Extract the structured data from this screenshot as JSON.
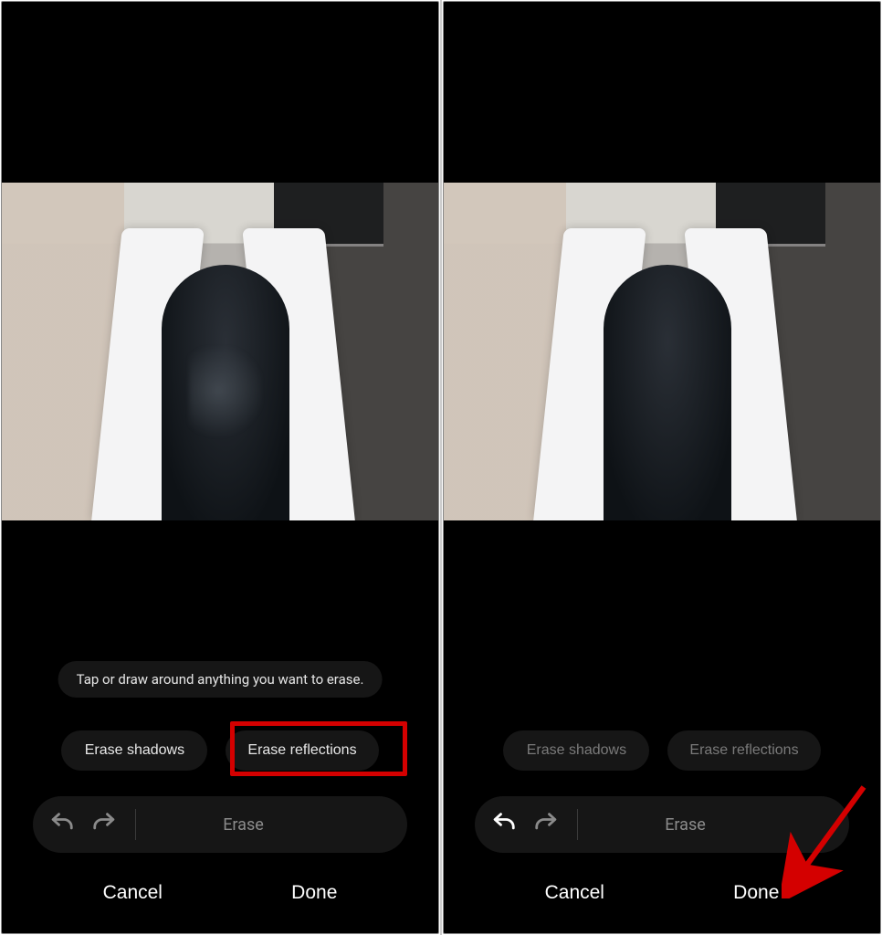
{
  "hint": "Tap or draw around anything you want to erase.",
  "chips": {
    "shadows": "Erase shadows",
    "reflections": "Erase reflections"
  },
  "tool": {
    "erase": "Erase"
  },
  "actions": {
    "cancel": "Cancel",
    "done": "Done"
  },
  "annotations": {
    "highlight_target": "erase-reflections-button",
    "arrow_target": "done-button"
  }
}
